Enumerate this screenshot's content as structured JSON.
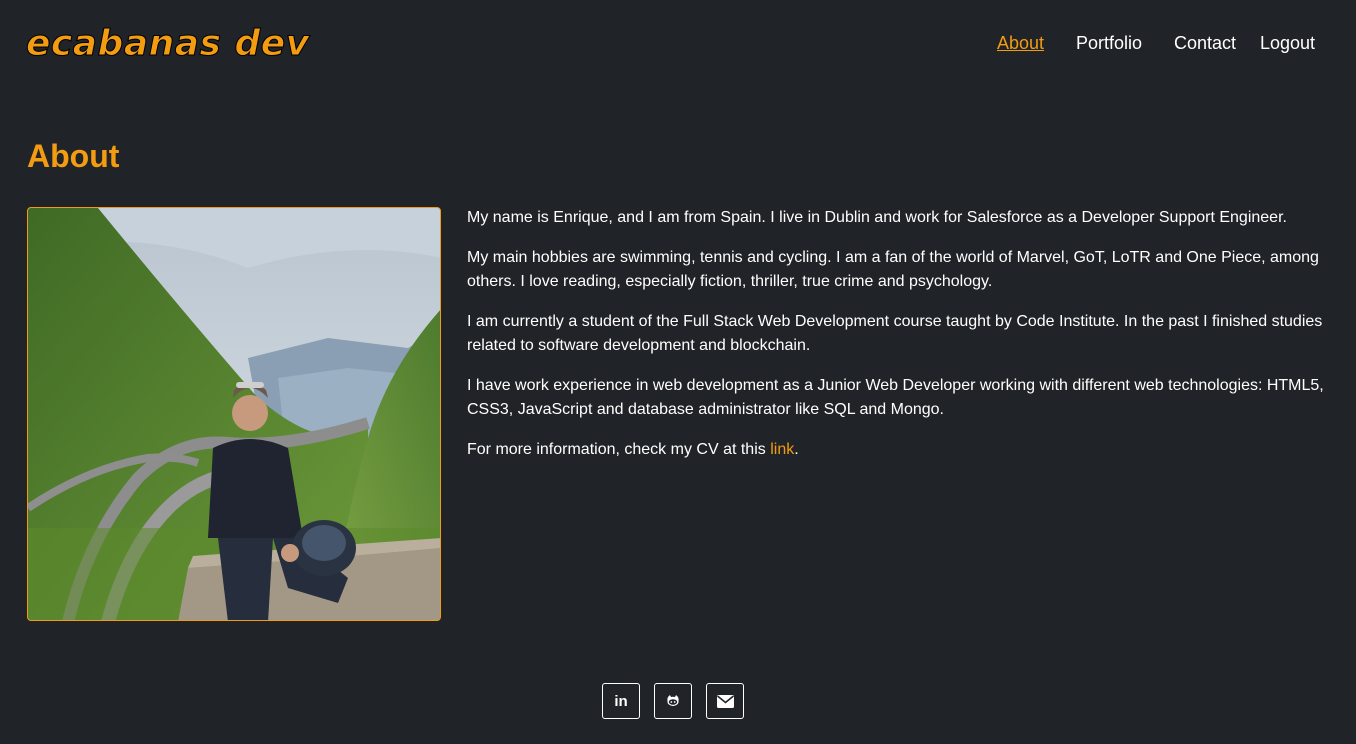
{
  "brand": {
    "logo_text": "ecabanas dev"
  },
  "nav": {
    "items": [
      {
        "label": "About",
        "active": true
      },
      {
        "label": "Portfolio"
      },
      {
        "label": "Contact"
      },
      {
        "label": "Logout"
      }
    ]
  },
  "main": {
    "heading": "About",
    "photo_alt": "Enrique sitting on a stone wall holding a helmet in front of a green mountain valley",
    "paragraphs": [
      "My name is Enrique, and I am from Spain. I live in Dublin and work for Salesforce as a Developer Support Engineer.",
      "My main hobbies are swimming, tennis and cycling. I am a fan of the world of Marvel, GoT, LoTR and One Piece, among others. I love reading, especially fiction, thriller, true crime and psychology.",
      "I am currently a student of the Full Stack Web Development course taught by Code Institute. In the past I finished studies related to software development and blockchain.",
      "I have work experience in web development as a Junior Web Developer working with different web technologies: HTML5, CSS3, JavaScript and database administrator like SQL and Mongo."
    ],
    "cv_prefix": "For more information, check my CV at this ",
    "cv_link": "link",
    "cv_suffix": "."
  },
  "footer": {
    "social": [
      {
        "icon": "linkedin-icon",
        "glyph": "in"
      },
      {
        "icon": "github-icon",
        "glyph": ""
      },
      {
        "icon": "envelope-icon",
        "glyph": ""
      }
    ]
  },
  "colors": {
    "background": "#202327",
    "accent": "#f39c12",
    "text": "#ffffff"
  }
}
